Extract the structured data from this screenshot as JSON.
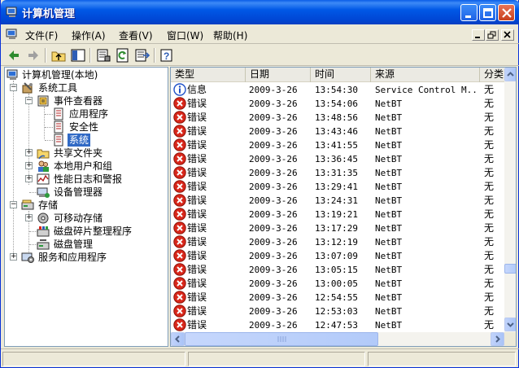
{
  "window": {
    "title": "计算机管理"
  },
  "menu": {
    "items": [
      "文件(F)",
      "操作(A)",
      "查看(V)",
      "窗口(W)",
      "帮助(H)"
    ]
  },
  "tree": {
    "root": "计算机管理(本地)",
    "system_tools": "系统工具",
    "event_viewer": "事件查看器",
    "application": "应用程序",
    "security": "安全性",
    "system": "系统",
    "shared_folders": "共享文件夹",
    "local_users": "本地用户和组",
    "perf_logs": "性能日志和警报",
    "device_manager": "设备管理器",
    "storage": "存储",
    "removable": "可移动存储",
    "defrag": "磁盘碎片整理程序",
    "disk_mgmt": "磁盘管理",
    "services": "服务和应用程序"
  },
  "list": {
    "columns": [
      "类型",
      "日期",
      "时间",
      "来源",
      "分类"
    ],
    "rows": [
      {
        "type": "信息",
        "icon": "info-icon",
        "date": "2009-3-26",
        "time": "13:54:30",
        "source": "Service Control M...",
        "category": "无"
      },
      {
        "type": "错误",
        "icon": "error-icon",
        "date": "2009-3-26",
        "time": "13:54:06",
        "source": "NetBT",
        "category": "无"
      },
      {
        "type": "错误",
        "icon": "error-icon",
        "date": "2009-3-26",
        "time": "13:48:56",
        "source": "NetBT",
        "category": "无"
      },
      {
        "type": "错误",
        "icon": "error-icon",
        "date": "2009-3-26",
        "time": "13:43:46",
        "source": "NetBT",
        "category": "无"
      },
      {
        "type": "错误",
        "icon": "error-icon",
        "date": "2009-3-26",
        "time": "13:41:55",
        "source": "NetBT",
        "category": "无"
      },
      {
        "type": "错误",
        "icon": "error-icon",
        "date": "2009-3-26",
        "time": "13:36:45",
        "source": "NetBT",
        "category": "无"
      },
      {
        "type": "错误",
        "icon": "error-icon",
        "date": "2009-3-26",
        "time": "13:31:35",
        "source": "NetBT",
        "category": "无"
      },
      {
        "type": "错误",
        "icon": "error-icon",
        "date": "2009-3-26",
        "time": "13:29:41",
        "source": "NetBT",
        "category": "无"
      },
      {
        "type": "错误",
        "icon": "error-icon",
        "date": "2009-3-26",
        "time": "13:24:31",
        "source": "NetBT",
        "category": "无"
      },
      {
        "type": "错误",
        "icon": "error-icon",
        "date": "2009-3-26",
        "time": "13:19:21",
        "source": "NetBT",
        "category": "无"
      },
      {
        "type": "错误",
        "icon": "error-icon",
        "date": "2009-3-26",
        "time": "13:17:29",
        "source": "NetBT",
        "category": "无"
      },
      {
        "type": "错误",
        "icon": "error-icon",
        "date": "2009-3-26",
        "time": "13:12:19",
        "source": "NetBT",
        "category": "无"
      },
      {
        "type": "错误",
        "icon": "error-icon",
        "date": "2009-3-26",
        "time": "13:07:09",
        "source": "NetBT",
        "category": "无"
      },
      {
        "type": "错误",
        "icon": "error-icon",
        "date": "2009-3-26",
        "time": "13:05:15",
        "source": "NetBT",
        "category": "无"
      },
      {
        "type": "错误",
        "icon": "error-icon",
        "date": "2009-3-26",
        "time": "13:00:05",
        "source": "NetBT",
        "category": "无"
      },
      {
        "type": "错误",
        "icon": "error-icon",
        "date": "2009-3-26",
        "time": "12:54:55",
        "source": "NetBT",
        "category": "无"
      },
      {
        "type": "错误",
        "icon": "error-icon",
        "date": "2009-3-26",
        "time": "12:53:03",
        "source": "NetBT",
        "category": "无"
      },
      {
        "type": "错误",
        "icon": "error-icon",
        "date": "2009-3-26",
        "time": "12:47:53",
        "source": "NetBT",
        "category": "无"
      }
    ]
  },
  "colors": {
    "titlebar": "#0058E6",
    "selection": "#316AC5",
    "error": "#D8271B",
    "info": "#1F50C8"
  }
}
